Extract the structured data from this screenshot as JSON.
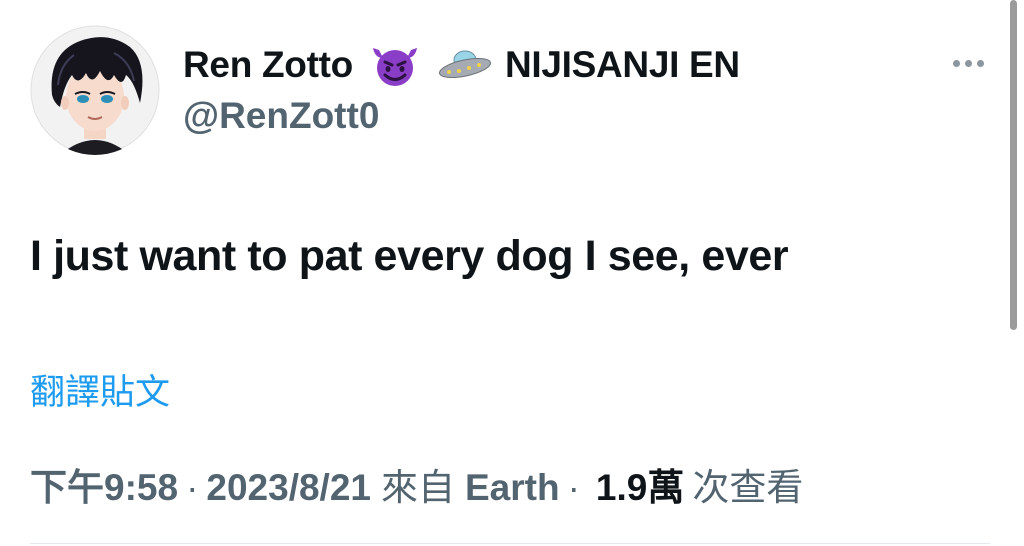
{
  "author": {
    "display_name": "Ren Zotto",
    "badge_emoji_1": "smiling-devil-icon",
    "badge_emoji_2": "ufo-icon",
    "org": "NIJISANJI EN",
    "handle": "@RenZott0",
    "avatar": "avatar-anime-boy"
  },
  "tweet": {
    "text": "I just want to pat every dog I see, ever",
    "translate_label": "翻譯貼文"
  },
  "meta": {
    "time": "下午9:58",
    "separator": "·",
    "date": "2023/8/21",
    "source_prefix": "來自",
    "source": "Earth",
    "views_count": "1.9萬",
    "views_label": "次查看"
  },
  "colors": {
    "text_primary": "#0f1419",
    "text_secondary": "#536471",
    "link": "#1d9bf0"
  }
}
